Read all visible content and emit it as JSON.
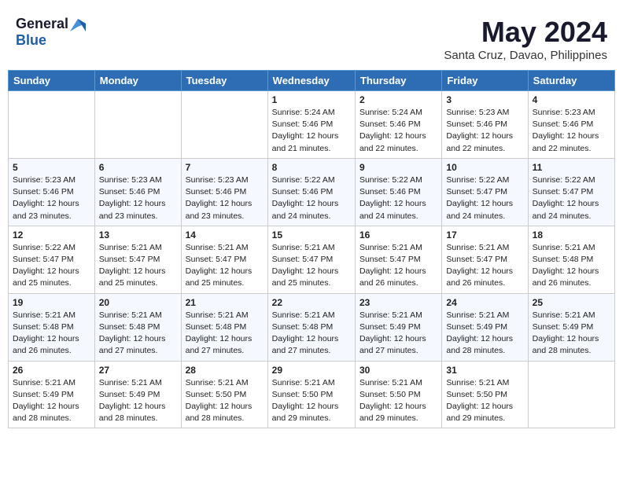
{
  "header": {
    "logo_general": "General",
    "logo_blue": "Blue",
    "month": "May 2024",
    "location": "Santa Cruz, Davao, Philippines"
  },
  "weekdays": [
    "Sunday",
    "Monday",
    "Tuesday",
    "Wednesday",
    "Thursday",
    "Friday",
    "Saturday"
  ],
  "weeks": [
    [
      {
        "day": "",
        "info": ""
      },
      {
        "day": "",
        "info": ""
      },
      {
        "day": "",
        "info": ""
      },
      {
        "day": "1",
        "info": "Sunrise: 5:24 AM\nSunset: 5:46 PM\nDaylight: 12 hours\nand 21 minutes."
      },
      {
        "day": "2",
        "info": "Sunrise: 5:24 AM\nSunset: 5:46 PM\nDaylight: 12 hours\nand 22 minutes."
      },
      {
        "day": "3",
        "info": "Sunrise: 5:23 AM\nSunset: 5:46 PM\nDaylight: 12 hours\nand 22 minutes."
      },
      {
        "day": "4",
        "info": "Sunrise: 5:23 AM\nSunset: 5:46 PM\nDaylight: 12 hours\nand 22 minutes."
      }
    ],
    [
      {
        "day": "5",
        "info": "Sunrise: 5:23 AM\nSunset: 5:46 PM\nDaylight: 12 hours\nand 23 minutes."
      },
      {
        "day": "6",
        "info": "Sunrise: 5:23 AM\nSunset: 5:46 PM\nDaylight: 12 hours\nand 23 minutes."
      },
      {
        "day": "7",
        "info": "Sunrise: 5:23 AM\nSunset: 5:46 PM\nDaylight: 12 hours\nand 23 minutes."
      },
      {
        "day": "8",
        "info": "Sunrise: 5:22 AM\nSunset: 5:46 PM\nDaylight: 12 hours\nand 24 minutes."
      },
      {
        "day": "9",
        "info": "Sunrise: 5:22 AM\nSunset: 5:46 PM\nDaylight: 12 hours\nand 24 minutes."
      },
      {
        "day": "10",
        "info": "Sunrise: 5:22 AM\nSunset: 5:47 PM\nDaylight: 12 hours\nand 24 minutes."
      },
      {
        "day": "11",
        "info": "Sunrise: 5:22 AM\nSunset: 5:47 PM\nDaylight: 12 hours\nand 24 minutes."
      }
    ],
    [
      {
        "day": "12",
        "info": "Sunrise: 5:22 AM\nSunset: 5:47 PM\nDaylight: 12 hours\nand 25 minutes."
      },
      {
        "day": "13",
        "info": "Sunrise: 5:21 AM\nSunset: 5:47 PM\nDaylight: 12 hours\nand 25 minutes."
      },
      {
        "day": "14",
        "info": "Sunrise: 5:21 AM\nSunset: 5:47 PM\nDaylight: 12 hours\nand 25 minutes."
      },
      {
        "day": "15",
        "info": "Sunrise: 5:21 AM\nSunset: 5:47 PM\nDaylight: 12 hours\nand 25 minutes."
      },
      {
        "day": "16",
        "info": "Sunrise: 5:21 AM\nSunset: 5:47 PM\nDaylight: 12 hours\nand 26 minutes."
      },
      {
        "day": "17",
        "info": "Sunrise: 5:21 AM\nSunset: 5:47 PM\nDaylight: 12 hours\nand 26 minutes."
      },
      {
        "day": "18",
        "info": "Sunrise: 5:21 AM\nSunset: 5:48 PM\nDaylight: 12 hours\nand 26 minutes."
      }
    ],
    [
      {
        "day": "19",
        "info": "Sunrise: 5:21 AM\nSunset: 5:48 PM\nDaylight: 12 hours\nand 26 minutes."
      },
      {
        "day": "20",
        "info": "Sunrise: 5:21 AM\nSunset: 5:48 PM\nDaylight: 12 hours\nand 27 minutes."
      },
      {
        "day": "21",
        "info": "Sunrise: 5:21 AM\nSunset: 5:48 PM\nDaylight: 12 hours\nand 27 minutes."
      },
      {
        "day": "22",
        "info": "Sunrise: 5:21 AM\nSunset: 5:48 PM\nDaylight: 12 hours\nand 27 minutes."
      },
      {
        "day": "23",
        "info": "Sunrise: 5:21 AM\nSunset: 5:49 PM\nDaylight: 12 hours\nand 27 minutes."
      },
      {
        "day": "24",
        "info": "Sunrise: 5:21 AM\nSunset: 5:49 PM\nDaylight: 12 hours\nand 28 minutes."
      },
      {
        "day": "25",
        "info": "Sunrise: 5:21 AM\nSunset: 5:49 PM\nDaylight: 12 hours\nand 28 minutes."
      }
    ],
    [
      {
        "day": "26",
        "info": "Sunrise: 5:21 AM\nSunset: 5:49 PM\nDaylight: 12 hours\nand 28 minutes."
      },
      {
        "day": "27",
        "info": "Sunrise: 5:21 AM\nSunset: 5:49 PM\nDaylight: 12 hours\nand 28 minutes."
      },
      {
        "day": "28",
        "info": "Sunrise: 5:21 AM\nSunset: 5:50 PM\nDaylight: 12 hours\nand 28 minutes."
      },
      {
        "day": "29",
        "info": "Sunrise: 5:21 AM\nSunset: 5:50 PM\nDaylight: 12 hours\nand 29 minutes."
      },
      {
        "day": "30",
        "info": "Sunrise: 5:21 AM\nSunset: 5:50 PM\nDaylight: 12 hours\nand 29 minutes."
      },
      {
        "day": "31",
        "info": "Sunrise: 5:21 AM\nSunset: 5:50 PM\nDaylight: 12 hours\nand 29 minutes."
      },
      {
        "day": "",
        "info": ""
      }
    ]
  ]
}
